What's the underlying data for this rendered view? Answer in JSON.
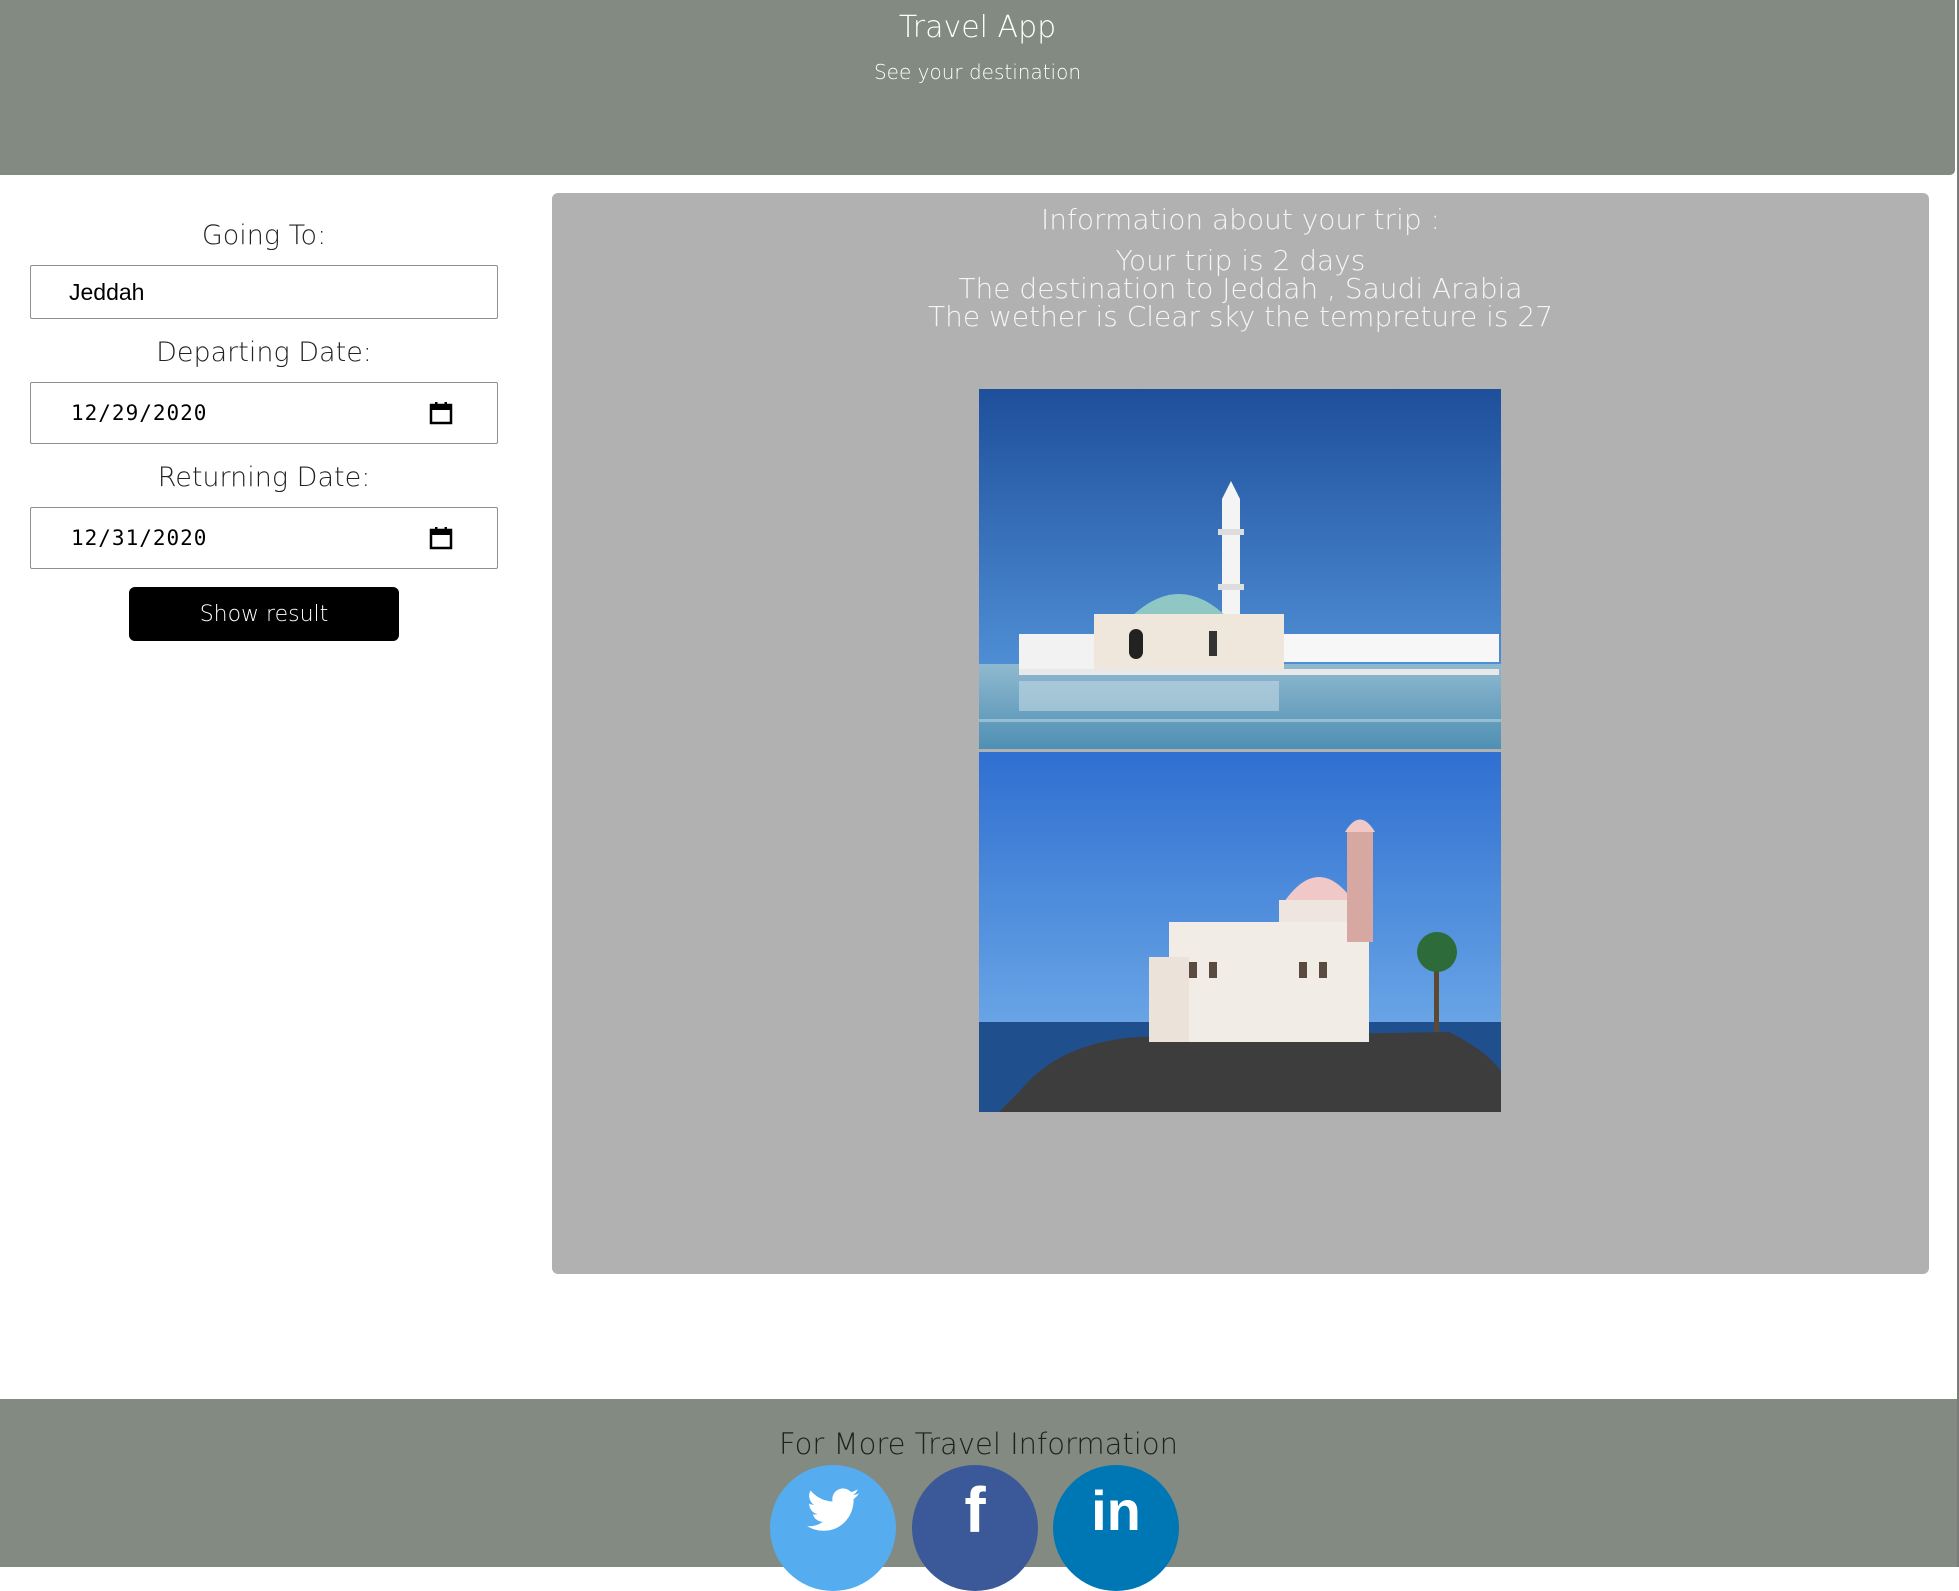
{
  "header": {
    "title": "Travel App",
    "subtitle": "See your destination",
    "background": "#838a82"
  },
  "form": {
    "destination_label": "Going To:",
    "destination_value": "Jeddah",
    "departing_label": "Departing Date:",
    "departing_value": "12/29/2020",
    "returning_label": "Returning Date:",
    "returning_value": "12/31/2020",
    "submit_label": "Show result"
  },
  "result": {
    "heading": "Information about your trip :",
    "lines": [
      "Your trip is 2 days",
      "The destination to Jeddah , Saudi Arabia",
      "The wether is Clear sky the tempreture is 27"
    ],
    "background": "#b1b1b1"
  },
  "footer": {
    "title": "For More Travel Information",
    "social": [
      {
        "name": "twitter",
        "icon": "twitter-icon",
        "color": "#55acee"
      },
      {
        "name": "facebook",
        "icon": "facebook-icon",
        "color": "#3b5998",
        "glyph": "f"
      },
      {
        "name": "linkedin",
        "icon": "linkedin-icon",
        "color": "#0077b5",
        "glyph": "in"
      }
    ]
  }
}
